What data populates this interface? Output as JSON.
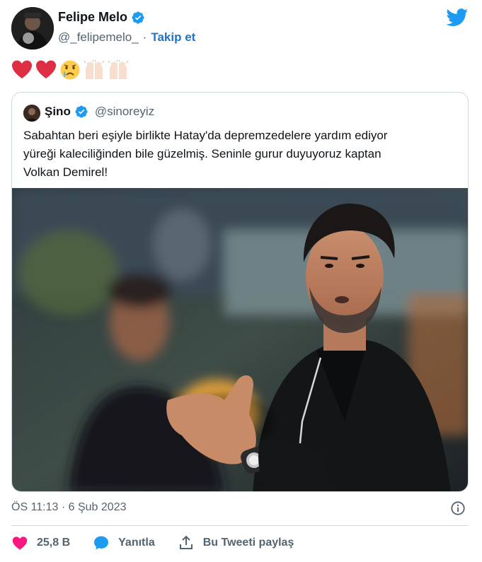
{
  "author": {
    "name": "Felipe Melo",
    "handle": "@_felipemelo_",
    "separator": "·",
    "follow_label": "Takip et"
  },
  "icons": {
    "brand": "twitter-bird-icon",
    "verified": "verified-badge-icon",
    "info": "info-icon",
    "like": "heart-icon",
    "reply": "speech-bubble-icon",
    "share": "share-upload-icon"
  },
  "emojis": [
    "red-heart",
    "red-heart",
    "crying-face",
    "raising-hands",
    "raising-hands"
  ],
  "quoted": {
    "name": "Şino",
    "handle": "@sinoreyiz",
    "text_lines": [
      "Sabahtan beri eşiyle birlikte Hatay'da depremzedelere yardım ediyor",
      "yüreği kaleciliğinden bile güzelmiş. Seninle gurur duyuyoruz kaptan",
      "Volkan Demirel!"
    ]
  },
  "footer": {
    "timestamp": "ÖS 11:13 · 6 Şub 2023",
    "like_count": "25,8 B",
    "reply_label": "Yanıtla",
    "share_label": "Bu Tweeti paylaş"
  },
  "colors": {
    "brand_blue": "#1d9bf0",
    "like_pink": "#f91880",
    "link_blue": "#1d74c9",
    "muted_text": "#536471",
    "border": "#cfd9de"
  }
}
